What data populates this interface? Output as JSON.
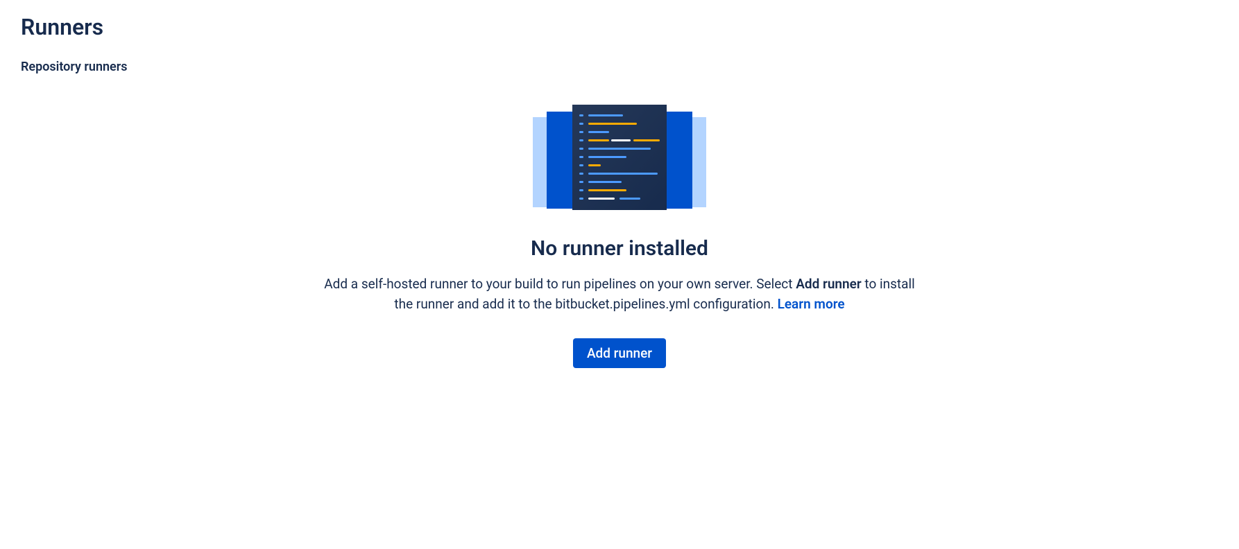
{
  "header": {
    "page_title": "Runners",
    "section_title": "Repository runners"
  },
  "empty_state": {
    "title": "No runner installed",
    "description_part1": "Add a self-hosted runner to your build to run pipelines on your own server. Select ",
    "description_bold": "Add runner",
    "description_part2": " to install the runner and add it to the bitbucket.pipelines.yml configuration. ",
    "learn_more_label": "Learn more",
    "add_button_label": "Add runner"
  }
}
